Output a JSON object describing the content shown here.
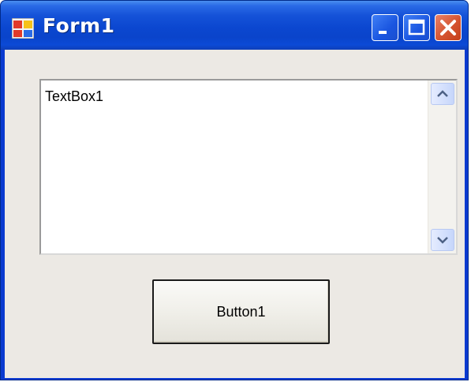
{
  "window": {
    "title": "Form1",
    "icon": "form-app-icon",
    "controls": {
      "minimize": "minimize-icon",
      "maximize": "maximize-icon",
      "close": "close-icon"
    }
  },
  "textbox": {
    "value": "TextBox1",
    "scrollbar": {
      "up_icon": "chevron-up-icon",
      "down_icon": "chevron-down-icon"
    }
  },
  "button": {
    "label": "Button1"
  },
  "colors": {
    "titlebar": "#0b47d0",
    "close_button": "#d5532f",
    "client_background": "#ece9e4"
  }
}
